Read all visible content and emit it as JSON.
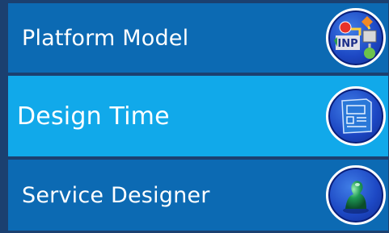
{
  "menu": {
    "items": [
      {
        "label": "Platform Model",
        "icon": "process-diagram-icon",
        "active": false
      },
      {
        "label": "Design Time",
        "icon": "blueprint-layout-icon",
        "active": true
      },
      {
        "label": "Service Designer",
        "icon": "green-figure-icon",
        "active": false
      }
    ]
  },
  "colors": {
    "background": "#1b4070",
    "item": "#0c6ab3",
    "item_active": "#11a9ea",
    "badge": "#1d48c4",
    "text": "#ffffff"
  }
}
